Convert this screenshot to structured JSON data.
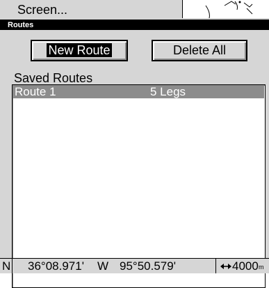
{
  "menu": {
    "label": "Screen..."
  },
  "window": {
    "title": "Routes"
  },
  "buttons": {
    "new_route": "New Route",
    "delete_all": "Delete All"
  },
  "saved_routes": {
    "label": "Saved Routes",
    "items": [
      {
        "name": "Route 1",
        "legs": "5 Legs"
      }
    ]
  },
  "status": {
    "lat_hemi": "N",
    "lat": "36°08.971'",
    "lon_hemi": "W",
    "lon": "95°50.579'",
    "range": "4000",
    "range_unit": "m",
    "range_icon": "horizontal-arrows-icon"
  },
  "colors": {
    "selected_row": "#8c8c8c",
    "panel": "#d6d6d6",
    "titlebar": "#000000"
  }
}
